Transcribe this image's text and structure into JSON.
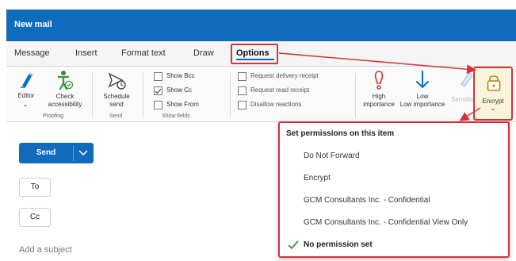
{
  "window": {
    "title": "New mail"
  },
  "tabs": [
    {
      "label": "Message"
    },
    {
      "label": "Insert"
    },
    {
      "label": "Format text"
    },
    {
      "label": "Draw"
    },
    {
      "label": "Options"
    }
  ],
  "ribbon": {
    "editor_label": "Editor",
    "check_accessibility_label_1": "Check",
    "check_accessibility_label_2": "accessibility",
    "proofing_group": "Proofing",
    "schedule_send_label_1": "Schedule",
    "schedule_send_label_2": "send",
    "send_group": "Send",
    "show_bcc": "Show Bcc",
    "show_cc": "Show Cc",
    "show_from": "Show From",
    "show_fields_group": "Show fields",
    "request_delivery": "Request delivery receipt",
    "request_read": "Request read receipt",
    "disallow_reactions": "Disallow reactions",
    "high_importance_label_1": "High",
    "high_importance_label_2": "importance",
    "low_importance_label": "Low importance",
    "sensitivity_label": "Sensitivity",
    "encrypt_label": "Encrypt"
  },
  "compose": {
    "send_label": "Send",
    "to_label": "To",
    "cc_label": "Cc",
    "subject_placeholder": "Add a subject"
  },
  "permissions_menu": {
    "header": "Set permissions on this item",
    "items": [
      {
        "label": "Do Not Forward"
      },
      {
        "label": "Encrypt"
      },
      {
        "label": "GCM Consultants Inc. - Confidential"
      },
      {
        "label": "GCM Consultants Inc. - Confidential View Only"
      },
      {
        "label": "No permission set"
      }
    ]
  },
  "colors": {
    "accent": "#0f6cbd",
    "highlight": "#d1343a",
    "check_green": "#3a8f3a"
  }
}
